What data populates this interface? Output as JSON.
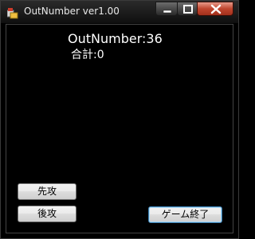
{
  "window": {
    "title": "OutNumber ver1.00",
    "icons": {
      "app": "app-icon",
      "minimize": "minimize-icon",
      "maximize": "maximize-icon",
      "close": "close-icon"
    }
  },
  "game": {
    "out_number_text": "OutNumber:36",
    "total_text": "合計:0"
  },
  "buttons": {
    "first_label": "先攻",
    "second_label": "後攻",
    "end_label": "ゲーム終了"
  },
  "colors": {
    "background": "#000000",
    "close_button": "#c0452e",
    "focus_border": "#3c7fb1"
  }
}
